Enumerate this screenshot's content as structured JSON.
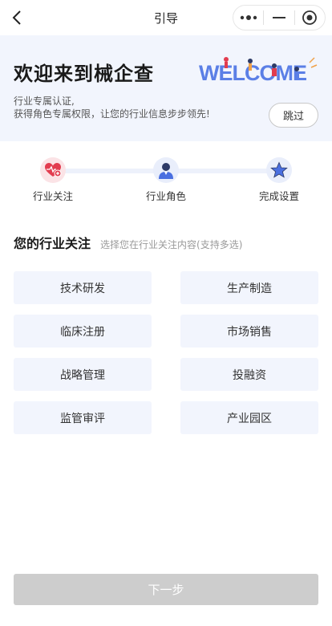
{
  "nav": {
    "title": "引导",
    "back_icon": "chevron-left-icon",
    "more_icon": "more-dots-icon",
    "minimize_icon": "minimize-icon",
    "close_icon": "target-close-icon"
  },
  "hero": {
    "title": "欢迎来到械企查",
    "subtitle_line1": "行业专属认证,",
    "subtitle_line2": "获得角色专属权限，让您的行业信息步步领先!",
    "welcome_art_text": "WELCOME",
    "skip_label": "跳过"
  },
  "steps": [
    {
      "label": "行业关注",
      "icon": "heart-plus-icon"
    },
    {
      "label": "行业角色",
      "icon": "person-icon"
    },
    {
      "label": "完成设置",
      "icon": "star-icon"
    }
  ],
  "section": {
    "title": "您的行业关注",
    "hint": "选择您在行业关注内容(支持多选)"
  },
  "options": [
    "技术研发",
    "生产制造",
    "临床注册",
    "市场销售",
    "战略管理",
    "投融资",
    "监管审评",
    "产业园区"
  ],
  "next_label": "下一步",
  "colors": {
    "hero_bg": "#f2f5fd",
    "chip_bg": "#f2f5fd",
    "accent_blue": "#4a6fe0",
    "heart_red": "#e23c4f",
    "next_disabled": "#cdcdcd"
  }
}
